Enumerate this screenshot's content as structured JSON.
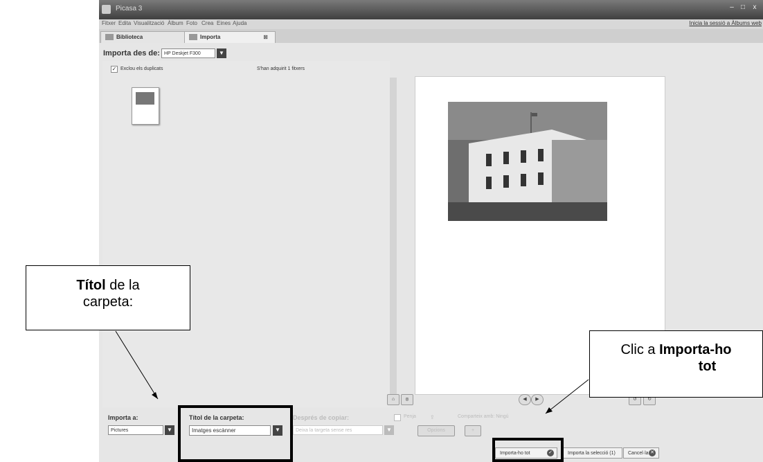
{
  "window": {
    "title": "Picasa 3",
    "minimize": "–",
    "maximize": "□",
    "close": "x"
  },
  "menu": [
    "Fitxer",
    "Edita",
    "Visualització",
    "Àlbum",
    "Foto",
    "Crea",
    "Eines",
    "Ajuda"
  ],
  "signin_link": "Inicia la sessió a Àlbums web",
  "tabs": {
    "library": "Biblioteca",
    "import": "Importa",
    "import_close": "⊠"
  },
  "import_from": {
    "label": "Importa des de:",
    "device": "HP Deskjet F300"
  },
  "exclude_duplicates": {
    "checked": true,
    "label": "Exclou els duplicats"
  },
  "acquired_status": "S'han adquirit 1 fitxers",
  "bottom": {
    "import_to_label": "Importa a:",
    "import_to_value": "Pictures",
    "folder_title_label": "Títol de la carpeta:",
    "folder_title_value": "Imatges escànner",
    "after_copy_label": "Després de copiar:",
    "after_copy_value": "Deixa la targeta sense res",
    "upload_label": "Penja",
    "share_label": "Comparteix amb: Ningú",
    "options_label": "Opcions"
  },
  "actions": {
    "import_all": "Importa-ho tot",
    "import_selection": "Importa la selecció (1)",
    "cancel": "Cancel·la"
  },
  "annotations": {
    "folder_title_bold": "Títol",
    "folder_title_rest_1": " de la",
    "folder_title_rest_2": "carpeta:",
    "click_prefix": "Clic a ",
    "click_bold_1": "Importa-ho",
    "click_bold_2": "tot"
  }
}
